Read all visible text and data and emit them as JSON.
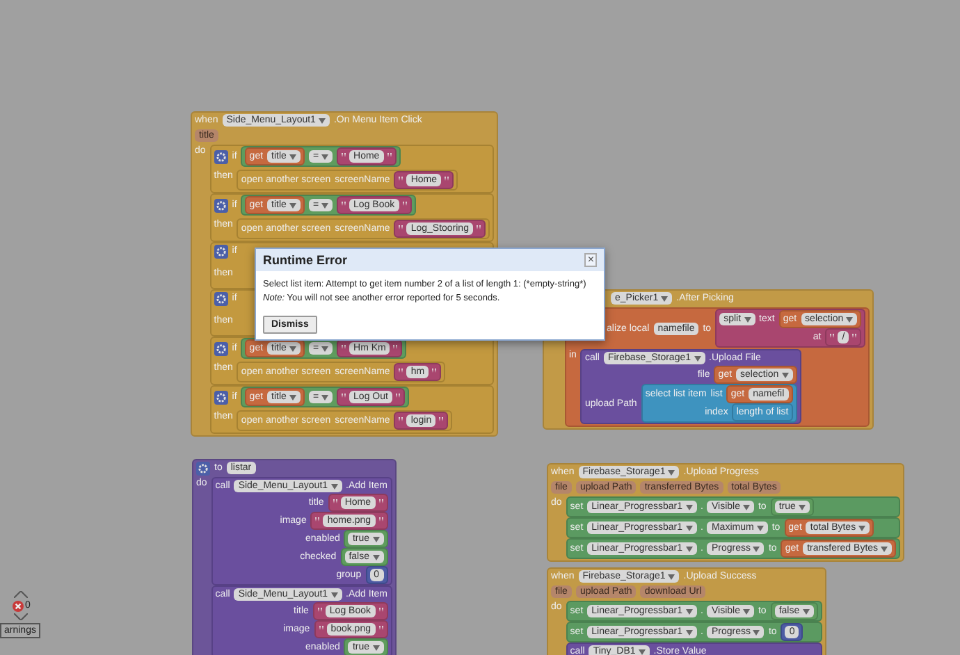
{
  "stacks": [
    {
      "kind": "event",
      "rows": [
        {
          "items": [
            {
              "kind": "label",
              "t": "when"
            },
            {
              "kind": "dropdown",
              "t": "Side_Menu_Layout1"
            },
            {
              "kind": "label",
              "t": ".On Menu Item Click"
            }
          ]
        },
        {
          "items": [
            {
              "kind": "param",
              "t": "title"
            }
          ]
        },
        {
          "items": [
            {
              "kind": "label",
              "t": "do"
            }
          ],
          "body": [
            {
              "kind": "control",
              "rows": [
                {
                  "items": [
                    {
                      "kind": "gear"
                    },
                    {
                      "kind": "label",
                      "t": "if"
                    },
                    {
                      "kind": "block",
                      "block": {
                        "kind": "logic",
                        "rows": [
                          {
                            "items": [
                              {
                                "kind": "block",
                                "block": {
                                  "kind": "variable",
                                  "rows": [
                                    {
                                      "items": [
                                        {
                                          "kind": "label",
                                          "t": "get"
                                        },
                                        {
                                          "kind": "dropdown",
                                          "t": "title"
                                        }
                                      ]
                                    }
                                  ]
                                }
                              },
                              {
                                "kind": "dropdown",
                                "t": "="
                              },
                              {
                                "kind": "string",
                                "t": "Home"
                              }
                            ]
                          }
                        ]
                      }
                    }
                  ]
                },
                {
                  "items": [
                    {
                      "kind": "label",
                      "t": "then"
                    }
                  ],
                  "body": [
                    {
                      "kind": "control",
                      "rows": [
                        {
                          "items": [
                            {
                              "kind": "label",
                              "t": "open another screen"
                            },
                            {
                              "kind": "label",
                              "t": "screenName"
                            },
                            {
                              "kind": "string",
                              "t": "Home"
                            }
                          ]
                        }
                      ]
                    }
                  ]
                }
              ]
            },
            {
              "kind": "control",
              "rows": [
                {
                  "items": [
                    {
                      "kind": "gear"
                    },
                    {
                      "kind": "label",
                      "t": "if"
                    },
                    {
                      "kind": "block",
                      "block": {
                        "kind": "logic",
                        "rows": [
                          {
                            "items": [
                              {
                                "kind": "block",
                                "block": {
                                  "kind": "variable",
                                  "rows": [
                                    {
                                      "items": [
                                        {
                                          "kind": "label",
                                          "t": "get"
                                        },
                                        {
                                          "kind": "dropdown",
                                          "t": "title"
                                        }
                                      ]
                                    }
                                  ]
                                }
                              },
                              {
                                "kind": "dropdown",
                                "t": "="
                              },
                              {
                                "kind": "string",
                                "t": "Log Book"
                              }
                            ]
                          }
                        ]
                      }
                    }
                  ]
                },
                {
                  "items": [
                    {
                      "kind": "label",
                      "t": "then"
                    }
                  ],
                  "body": [
                    {
                      "kind": "control",
                      "rows": [
                        {
                          "items": [
                            {
                              "kind": "label",
                              "t": "open another screen"
                            },
                            {
                              "kind": "label",
                              "t": "screenName"
                            },
                            {
                              "kind": "string",
                              "t": "Log_Stooring"
                            }
                          ]
                        }
                      ]
                    }
                  ]
                }
              ]
            },
            {
              "kind": "control",
              "rows": [
                {
                  "items": [
                    {
                      "kind": "gear"
                    },
                    {
                      "kind": "label",
                      "t": "if"
                    }
                  ]
                },
                {
                  "items": [
                    {
                      "kind": "label",
                      "t": "then"
                    }
                  ]
                }
              ]
            },
            {
              "kind": "control",
              "rows": [
                {
                  "items": [
                    {
                      "kind": "gear"
                    },
                    {
                      "kind": "label",
                      "t": "if"
                    }
                  ]
                },
                {
                  "items": [
                    {
                      "kind": "label",
                      "t": "then"
                    }
                  ]
                }
              ]
            },
            {
              "kind": "control",
              "rows": [
                {
                  "items": [
                    {
                      "kind": "gear"
                    },
                    {
                      "kind": "label",
                      "t": "if"
                    },
                    {
                      "kind": "block",
                      "block": {
                        "kind": "logic",
                        "rows": [
                          {
                            "items": [
                              {
                                "kind": "block",
                                "block": {
                                  "kind": "variable",
                                  "rows": [
                                    {
                                      "items": [
                                        {
                                          "kind": "label",
                                          "t": "get"
                                        },
                                        {
                                          "kind": "dropdown",
                                          "t": "title"
                                        }
                                      ]
                                    }
                                  ]
                                }
                              },
                              {
                                "kind": "dropdown",
                                "t": "="
                              },
                              {
                                "kind": "string",
                                "t": "Hm Km"
                              }
                            ]
                          }
                        ]
                      }
                    }
                  ]
                },
                {
                  "items": [
                    {
                      "kind": "label",
                      "t": "then"
                    }
                  ],
                  "body": [
                    {
                      "kind": "control",
                      "rows": [
                        {
                          "items": [
                            {
                              "kind": "label",
                              "t": "open another screen"
                            },
                            {
                              "kind": "label",
                              "t": "screenName"
                            },
                            {
                              "kind": "string",
                              "t": "hm"
                            }
                          ]
                        }
                      ]
                    }
                  ]
                }
              ]
            },
            {
              "kind": "control",
              "rows": [
                {
                  "items": [
                    {
                      "kind": "gear"
                    },
                    {
                      "kind": "label",
                      "t": "if"
                    },
                    {
                      "kind": "block",
                      "block": {
                        "kind": "logic",
                        "rows": [
                          {
                            "items": [
                              {
                                "kind": "block",
                                "block": {
                                  "kind": "variable",
                                  "rows": [
                                    {
                                      "items": [
                                        {
                                          "kind": "label",
                                          "t": "get"
                                        },
                                        {
                                          "kind": "dropdown",
                                          "t": "title"
                                        }
                                      ]
                                    }
                                  ]
                                }
                              },
                              {
                                "kind": "dropdown",
                                "t": "="
                              },
                              {
                                "kind": "string",
                                "t": "Log Out"
                              }
                            ]
                          }
                        ]
                      }
                    }
                  ]
                },
                {
                  "items": [
                    {
                      "kind": "label",
                      "t": "then"
                    }
                  ],
                  "body": [
                    {
                      "kind": "control",
                      "rows": [
                        {
                          "items": [
                            {
                              "kind": "label",
                              "t": "open another screen"
                            },
                            {
                              "kind": "label",
                              "t": "screenName"
                            },
                            {
                              "kind": "string",
                              "t": "login"
                            }
                          ]
                        }
                      ]
                    }
                  ]
                }
              ]
            }
          ]
        }
      ]
    },
    {
      "kind": "event",
      "rows": [
        {
          "items": [
            {
              "kind": "dropdown",
              "t": "e_Picker1"
            },
            {
              "kind": "label",
              "t": ".After Picking"
            }
          ]
        },
        {
          "items": [],
          "body": [
            {
              "kind": "variable",
              "rows": [
                {
                  "items": [
                    {
                      "kind": "label",
                      "t": "alize local"
                    },
                    {
                      "kind": "field",
                      "t": "namefile"
                    },
                    {
                      "kind": "label",
                      "t": "to"
                    },
                    {
                      "kind": "block",
                      "block": {
                        "kind": "text",
                        "rows": [
                          {
                            "items": [
                              {
                                "kind": "dropdown",
                                "t": "split"
                              },
                              {
                                "kind": "label",
                                "t": "text"
                              },
                              {
                                "kind": "block",
                                "block": {
                                  "kind": "variable",
                                  "rows": [
                                    {
                                      "items": [
                                        {
                                          "kind": "label",
                                          "t": "get"
                                        },
                                        {
                                          "kind": "dropdown",
                                          "t": "selection"
                                        }
                                      ]
                                    }
                                  ]
                                }
                              }
                            ]
                          },
                          {
                            "items": [
                              {
                                "kind": "label",
                                "t": "at"
                              },
                              {
                                "kind": "string",
                                "t": "/"
                              }
                            ]
                          }
                        ]
                      }
                    }
                  ]
                },
                {
                  "items": [
                    {
                      "kind": "label",
                      "t": "in"
                    }
                  ],
                  "body": [
                    {
                      "kind": "component",
                      "rows": [
                        {
                          "items": [
                            {
                              "kind": "label",
                              "t": "call"
                            },
                            {
                              "kind": "dropdown",
                              "t": "Firebase_Storage1"
                            },
                            {
                              "kind": "label",
                              "t": ".Upload File"
                            }
                          ]
                        },
                        {
                          "items": [
                            {
                              "kind": "label",
                              "t": "file"
                            },
                            {
                              "kind": "block",
                              "block": {
                                "kind": "variable",
                                "rows": [
                                  {
                                    "items": [
                                      {
                                        "kind": "label",
                                        "t": "get"
                                      },
                                      {
                                        "kind": "dropdown",
                                        "t": "selection"
                                      }
                                    ]
                                  }
                                ]
                              }
                            }
                          ]
                        },
                        {
                          "items": [
                            {
                              "kind": "label",
                              "t": "upload Path"
                            },
                            {
                              "kind": "block",
                              "block": {
                                "kind": "list",
                                "rows": [
                                  {
                                    "items": [
                                      {
                                        "kind": "label",
                                        "t": "select list item"
                                      },
                                      {
                                        "kind": "label",
                                        "t": "list"
                                      },
                                      {
                                        "kind": "block",
                                        "block": {
                                          "kind": "variable",
                                          "rows": [
                                            {
                                              "items": [
                                                {
                                                  "kind": "label",
                                                  "t": "get"
                                                },
                                                {
                                                  "kind": "field",
                                                  "t": "namefil"
                                                }
                                              ]
                                            }
                                          ]
                                        }
                                      }
                                    ]
                                  },
                                  {
                                    "items": [
                                      {
                                        "kind": "label",
                                        "t": "index"
                                      },
                                      {
                                        "kind": "block",
                                        "block": {
                                          "kind": "list",
                                          "rows": [
                                            {
                                              "items": [
                                                {
                                                  "kind": "label",
                                                  "t": "length of list"
                                                }
                                              ]
                                            }
                                          ]
                                        }
                                      }
                                    ]
                                  }
                                ]
                              }
                            }
                          ]
                        }
                      ]
                    }
                  ]
                }
              ]
            }
          ]
        }
      ]
    },
    {
      "kind": "event",
      "rows": [
        {
          "items": [
            {
              "kind": "label",
              "t": "when"
            },
            {
              "kind": "dropdown",
              "t": "Firebase_Storage1"
            },
            {
              "kind": "label",
              "t": ".Upload Progress"
            }
          ]
        },
        {
          "items": [
            {
              "kind": "param",
              "t": "file"
            },
            {
              "kind": "param",
              "t": "upload Path"
            },
            {
              "kind": "param",
              "t": "transferred Bytes"
            },
            {
              "kind": "param",
              "t": "total Bytes"
            }
          ]
        },
        {
          "items": [
            {
              "kind": "label",
              "t": "do"
            }
          ],
          "body": [
            {
              "kind": "setter",
              "rows": [
                {
                  "items": [
                    {
                      "kind": "label",
                      "t": "set"
                    },
                    {
                      "kind": "dropdown",
                      "t": "Linear_Progressbar1"
                    },
                    {
                      "kind": "label",
                      "t": "."
                    },
                    {
                      "kind": "dropdown",
                      "t": "Visible"
                    },
                    {
                      "kind": "label",
                      "t": "to"
                    },
                    {
                      "kind": "boolean",
                      "t": "true"
                    }
                  ]
                }
              ]
            },
            {
              "kind": "setter",
              "rows": [
                {
                  "items": [
                    {
                      "kind": "label",
                      "t": "set"
                    },
                    {
                      "kind": "dropdown",
                      "t": "Linear_Progressbar1"
                    },
                    {
                      "kind": "label",
                      "t": "."
                    },
                    {
                      "kind": "dropdown",
                      "t": "Maximum"
                    },
                    {
                      "kind": "label",
                      "t": "to"
                    },
                    {
                      "kind": "block",
                      "block": {
                        "kind": "variable",
                        "rows": [
                          {
                            "items": [
                              {
                                "kind": "label",
                                "t": "get"
                              },
                              {
                                "kind": "dropdown",
                                "t": "total Bytes"
                              }
                            ]
                          }
                        ]
                      }
                    }
                  ]
                }
              ]
            },
            {
              "kind": "setter",
              "rows": [
                {
                  "items": [
                    {
                      "kind": "label",
                      "t": "set"
                    },
                    {
                      "kind": "dropdown",
                      "t": "Linear_Progressbar1"
                    },
                    {
                      "kind": "label",
                      "t": "."
                    },
                    {
                      "kind": "dropdown",
                      "t": "Progress"
                    },
                    {
                      "kind": "label",
                      "t": "to"
                    },
                    {
                      "kind": "block",
                      "block": {
                        "kind": "variable",
                        "rows": [
                          {
                            "items": [
                              {
                                "kind": "label",
                                "t": "get"
                              },
                              {
                                "kind": "dropdown",
                                "t": "transfered Bytes"
                              }
                            ]
                          }
                        ]
                      }
                    }
                  ]
                }
              ]
            }
          ]
        }
      ]
    },
    {
      "kind": "event",
      "rows": [
        {
          "items": [
            {
              "kind": "label",
              "t": "when"
            },
            {
              "kind": "dropdown",
              "t": "Firebase_Storage1"
            },
            {
              "kind": "label",
              "t": ".Upload Success"
            }
          ]
        },
        {
          "items": [
            {
              "kind": "param",
              "t": "file"
            },
            {
              "kind": "param",
              "t": "upload Path"
            },
            {
              "kind": "param",
              "t": "download Url"
            }
          ]
        },
        {
          "items": [
            {
              "kind": "label",
              "t": "do"
            }
          ],
          "body": [
            {
              "kind": "setter",
              "rows": [
                {
                  "items": [
                    {
                      "kind": "label",
                      "t": "set"
                    },
                    {
                      "kind": "dropdown",
                      "t": "Linear_Progressbar1"
                    },
                    {
                      "kind": "label",
                      "t": "."
                    },
                    {
                      "kind": "dropdown",
                      "t": "Visible"
                    },
                    {
                      "kind": "label",
                      "t": "to"
                    },
                    {
                      "kind": "boolean",
                      "t": "false"
                    }
                  ]
                }
              ]
            },
            {
              "kind": "setter",
              "rows": [
                {
                  "items": [
                    {
                      "kind": "label",
                      "t": "set"
                    },
                    {
                      "kind": "dropdown",
                      "t": "Linear_Progressbar1"
                    },
                    {
                      "kind": "label",
                      "t": "."
                    },
                    {
                      "kind": "dropdown",
                      "t": "Progress"
                    },
                    {
                      "kind": "label",
                      "t": "to"
                    },
                    {
                      "kind": "number",
                      "t": "0"
                    }
                  ]
                }
              ]
            },
            {
              "kind": "component",
              "rows": [
                {
                  "items": [
                    {
                      "kind": "label",
                      "t": "call"
                    },
                    {
                      "kind": "dropdown",
                      "t": "Tiny_DB1"
                    },
                    {
                      "kind": "label",
                      "t": ".Store Value"
                    }
                  ]
                }
              ]
            }
          ]
        }
      ]
    },
    {
      "kind": "procedure",
      "rows": [
        {
          "items": [
            {
              "kind": "gear"
            },
            {
              "kind": "label",
              "t": "to"
            },
            {
              "kind": "field",
              "t": "listar"
            }
          ]
        },
        {
          "items": [
            {
              "kind": "label",
              "t": "do"
            }
          ],
          "body": [
            {
              "kind": "component",
              "rows": [
                {
                  "items": [
                    {
                      "kind": "label",
                      "t": "call"
                    },
                    {
                      "kind": "dropdown",
                      "t": "Side_Menu_Layout1"
                    },
                    {
                      "kind": "label",
                      "t": ".Add Item"
                    }
                  ]
                },
                {
                  "items": [
                    {
                      "kind": "label",
                      "t": "title"
                    },
                    {
                      "kind": "string",
                      "t": "Home"
                    }
                  ]
                },
                {
                  "items": [
                    {
                      "kind": "label",
                      "t": "image"
                    },
                    {
                      "kind": "string",
                      "t": "home.png"
                    }
                  ]
                },
                {
                  "items": [
                    {
                      "kind": "label",
                      "t": "enabled"
                    },
                    {
                      "kind": "boolean",
                      "t": "true"
                    }
                  ]
                },
                {
                  "items": [
                    {
                      "kind": "label",
                      "t": "checked"
                    },
                    {
                      "kind": "boolean",
                      "t": "false"
                    }
                  ]
                },
                {
                  "items": [
                    {
                      "kind": "label",
                      "t": "group"
                    },
                    {
                      "kind": "number",
                      "t": "0"
                    }
                  ]
                }
              ]
            },
            {
              "kind": "component",
              "rows": [
                {
                  "items": [
                    {
                      "kind": "label",
                      "t": "call"
                    },
                    {
                      "kind": "dropdown",
                      "t": "Side_Menu_Layout1"
                    },
                    {
                      "kind": "label",
                      "t": ".Add Item"
                    }
                  ]
                },
                {
                  "items": [
                    {
                      "kind": "label",
                      "t": "title"
                    },
                    {
                      "kind": "string",
                      "t": "Log Book"
                    }
                  ]
                },
                {
                  "items": [
                    {
                      "kind": "label",
                      "t": "image"
                    },
                    {
                      "kind": "string",
                      "t": "book.png"
                    }
                  ]
                },
                {
                  "items": [
                    {
                      "kind": "label",
                      "t": "enabled"
                    },
                    {
                      "kind": "boolean",
                      "t": "true"
                    }
                  ]
                }
              ]
            }
          ]
        }
      ]
    }
  ],
  "dialog": {
    "title": "Runtime Error",
    "close": "×",
    "message": "Select list item: Attempt to get item number 2 of a list of length 1: (*empty-string*)",
    "note": "*Note:* You will not see another error reported for 5 seconds.",
    "button": "Dismiss"
  },
  "warnings": {
    "count": "0",
    "button": "arnings"
  }
}
